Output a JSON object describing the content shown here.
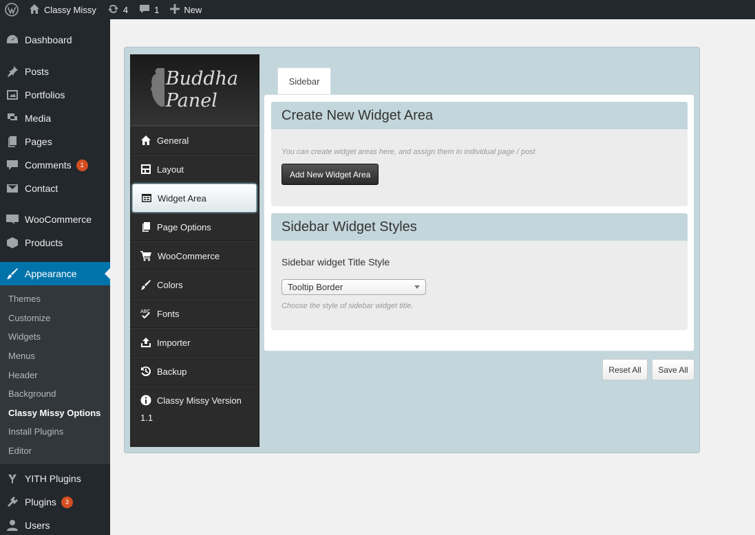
{
  "adminbar": {
    "site_name": "Classy Missy",
    "updates_count": "4",
    "comments_count": "1",
    "new_label": "New"
  },
  "menu": {
    "dashboard": "Dashboard",
    "posts": "Posts",
    "portfolios": "Portfolios",
    "media": "Media",
    "pages": "Pages",
    "comments": "Comments",
    "comments_badge": "1",
    "contact": "Contact",
    "woocommerce": "WooCommerce",
    "products": "Products",
    "appearance": "Appearance",
    "submenu": [
      "Themes",
      "Customize",
      "Widgets",
      "Menus",
      "Header",
      "Background",
      "Classy Missy Options",
      "Install Plugins",
      "Editor"
    ],
    "yith": "YITH Plugins",
    "plugins": "Plugins",
    "plugins_badge": "3",
    "users": "Users"
  },
  "panel": {
    "logo_line1": "Buddha",
    "logo_line2": "Panel",
    "nav": {
      "general": "General",
      "layout": "Layout",
      "widget_area": "Widget Area",
      "page_options": "Page Options",
      "woocommerce": "WooCommerce",
      "colors": "Colors",
      "fonts": "Fonts",
      "importer": "Importer",
      "backup": "Backup",
      "version_label": "Classy Missy Version",
      "version_num": "1.1"
    },
    "tab_label": "Sidebar",
    "section1": {
      "title": "Create New Widget Area",
      "hint": "You can create widget areas here, and assign them in individual page / post",
      "button": "Add New Widget Area"
    },
    "section2": {
      "title": "Sidebar Widget Styles",
      "field_label": "Sidebar widget Title Style",
      "select_value": "Tooltip Border",
      "hint": "Choose the style of sidebar widget title."
    },
    "reset_label": "Reset All",
    "save_label": "Save All"
  },
  "colors": {
    "adminbar_bg": "#23282d",
    "menu_current": "#0073aa",
    "panel_bg": "#c3d6dc",
    "badge": "#d54e21"
  }
}
